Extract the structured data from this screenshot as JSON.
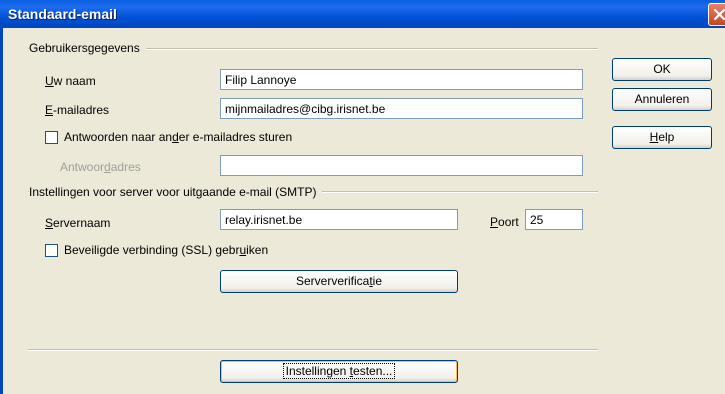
{
  "window": {
    "title": "Standaard-email"
  },
  "user_group": {
    "heading": "Gebruikersgegevens",
    "name_label_ul": "U",
    "name_label_rest": "w naam",
    "name_value": "Filip Lannoye",
    "email_label_ul": "E",
    "email_label_rest": "-mailadres",
    "email_value": "mijnmailadres@cibg.irisnet.be",
    "reply_checkbox_pre": "Antwoorden naar an",
    "reply_checkbox_ul": "d",
    "reply_checkbox_post": "er e-mailadres sturen",
    "reply_checked": false,
    "reply_label_pre": "Antwoor",
    "reply_label_ul": "d",
    "reply_label_post": "adres",
    "reply_value": ""
  },
  "smtp_group": {
    "heading": "Instellingen voor server voor uitgaande e-mail (SMTP)",
    "server_label_ul": "S",
    "server_label_rest": "ervernaam",
    "server_value": "relay.irisnet.be",
    "port_label_ul": "P",
    "port_label_rest": "oort",
    "port_value": "25",
    "ssl_pre": "Beveiligde verbinding (SSL) gebr",
    "ssl_ul": "u",
    "ssl_post": "iken",
    "ssl_checked": false,
    "verify_pre": "Serververifica",
    "verify_ul": "t",
    "verify_post": "ie"
  },
  "buttons": {
    "ok": "OK",
    "cancel": "Annuleren",
    "help_ul": "H",
    "help_rest": "elp",
    "test_pre": "Instellingen ",
    "test_ul": "t",
    "test_post": "esten..."
  }
}
